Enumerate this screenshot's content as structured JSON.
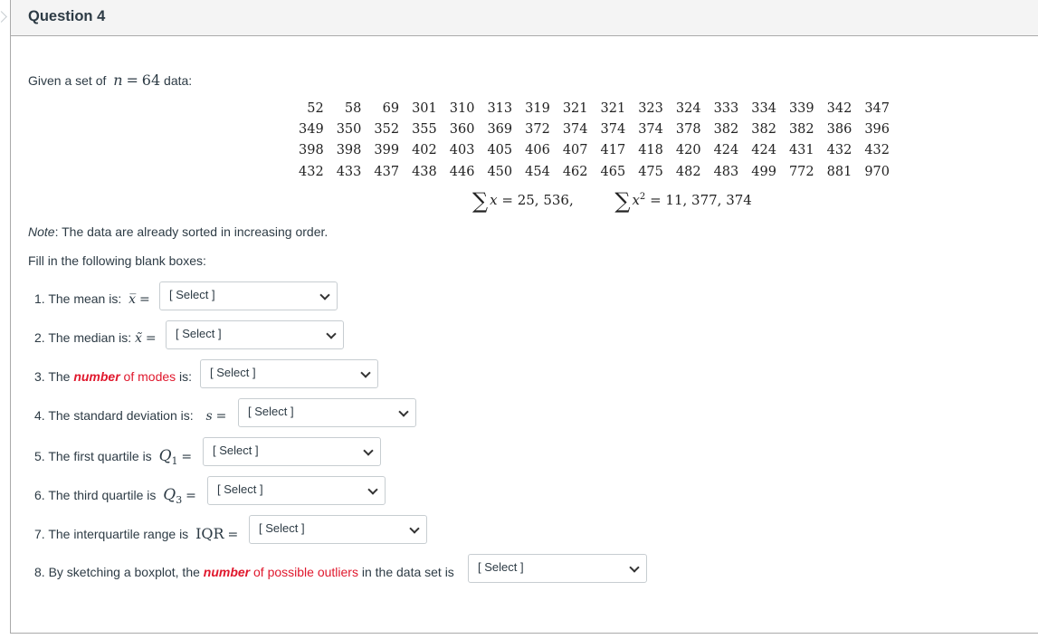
{
  "question": {
    "title": "Question 4",
    "intro_prefix": "Given a set of",
    "n_symbol": "n",
    "n_equals": "=",
    "n_value": "64",
    "intro_suffix": "data:",
    "data_rows": [
      [
        "52",
        "58",
        "69",
        "301",
        "310",
        "313",
        "319",
        "321",
        "321",
        "323",
        "324",
        "333",
        "334",
        "339",
        "342",
        "347"
      ],
      [
        "349",
        "350",
        "352",
        "355",
        "360",
        "369",
        "372",
        "374",
        "374",
        "374",
        "378",
        "382",
        "382",
        "382",
        "386",
        "396"
      ],
      [
        "398",
        "398",
        "399",
        "402",
        "403",
        "405",
        "406",
        "407",
        "417",
        "418",
        "420",
        "424",
        "424",
        "431",
        "432",
        "432"
      ],
      [
        "432",
        "433",
        "437",
        "438",
        "446",
        "450",
        "454",
        "462",
        "465",
        "475",
        "482",
        "483",
        "499",
        "772",
        "881",
        "970"
      ]
    ],
    "sum_x": {
      "sigma": "∑",
      "var": "x",
      "eq": " = 25, 536,"
    },
    "sum_x2": {
      "sigma": "∑",
      "var": "x",
      "sup": "2",
      "eq": " = 11, 377, 374"
    },
    "note_label": "Note",
    "note_text": ": The data are already sorted in increasing order.",
    "instruction": "Fill in the following blank boxes:",
    "items": [
      {
        "label": "1. The mean is:",
        "math": "x̅",
        "eq": "=",
        "select": "[ Select ]"
      },
      {
        "label": "2. The median is:",
        "math": "x̃",
        "eq": "=",
        "select": "[ Select ]"
      },
      {
        "label_pre": "3. The ",
        "label_red_bold": "number",
        "label_red": " of modes",
        "label_post": " is:",
        "select": "[ Select ]"
      },
      {
        "label": "4. The standard deviation is:",
        "math": "s",
        "eq": "=",
        "select": "[ Select ]"
      },
      {
        "label": "5. The first quartile is",
        "math": "Q",
        "sub": "1",
        "eq": "=",
        "select": "[ Select ]"
      },
      {
        "label": "6. The third quartile is",
        "math": "Q",
        "sub": "3",
        "eq": "=",
        "select": "[ Select ]"
      },
      {
        "label": "7. The interquartile range is",
        "math": "IQR",
        "eq": "=",
        "select": "[ Select ]"
      },
      {
        "label_pre": "8. By sketching a boxplot, the ",
        "label_red_bold": "number",
        "label_red": " of possible outliers",
        "label_post": " in the data set is",
        "select": "[ Select ]"
      }
    ]
  },
  "colors": {
    "accent_red": "#e0182d",
    "header_bg": "#f4f4f4",
    "text": "#2d3b45"
  }
}
